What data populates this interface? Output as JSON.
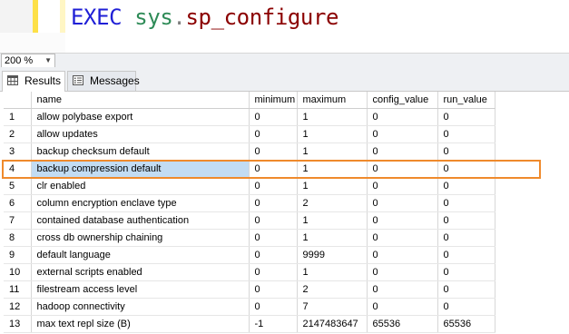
{
  "editor": {
    "keyword": "EXEC",
    "schema": "sys",
    "separator": ".",
    "procedure": "sp_configure"
  },
  "zoom": {
    "value": "200 %"
  },
  "tabs": [
    {
      "label": "Results",
      "active": true,
      "icon": "grid-icon"
    },
    {
      "label": "Messages",
      "active": false,
      "icon": "messages-icon"
    }
  ],
  "grid": {
    "columns": [
      "",
      "name",
      "minimum",
      "maximum",
      "config_value",
      "run_value"
    ],
    "highlighted_row": 4,
    "highlight_color": "#ef8a2c",
    "rows": [
      [
        "1",
        "allow polybase export",
        "0",
        "1",
        "0",
        "0"
      ],
      [
        "2",
        "allow updates",
        "0",
        "1",
        "0",
        "0"
      ],
      [
        "3",
        "backup checksum default",
        "0",
        "1",
        "0",
        "0"
      ],
      [
        "4",
        "backup compression default",
        "0",
        "1",
        "0",
        "0"
      ],
      [
        "5",
        "clr enabled",
        "0",
        "1",
        "0",
        "0"
      ],
      [
        "6",
        "column encryption enclave type",
        "0",
        "2",
        "0",
        "0"
      ],
      [
        "7",
        "contained database authentication",
        "0",
        "1",
        "0",
        "0"
      ],
      [
        "8",
        "cross db ownership chaining",
        "0",
        "1",
        "0",
        "0"
      ],
      [
        "9",
        "default language",
        "0",
        "9999",
        "0",
        "0"
      ],
      [
        "10",
        "external scripts enabled",
        "0",
        "1",
        "0",
        "0"
      ],
      [
        "11",
        "filestream access level",
        "0",
        "2",
        "0",
        "0"
      ],
      [
        "12",
        "hadoop connectivity",
        "0",
        "7",
        "0",
        "0"
      ],
      [
        "13",
        "max text repl size (B)",
        "-1",
        "2147483647",
        "65536",
        "65536"
      ]
    ]
  }
}
